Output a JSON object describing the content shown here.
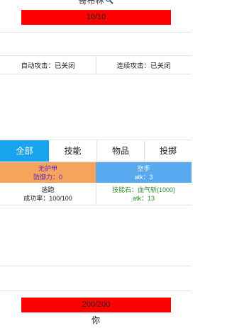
{
  "enemy": {
    "name": "哥布林",
    "hp_text": "10/10",
    "hp_fraction": 1.0
  },
  "toggles": {
    "auto_attack": "自动攻击：已关闭",
    "combo_attack": "连续攻击：已关闭"
  },
  "tabs": [
    {
      "label": "全部",
      "active": true
    },
    {
      "label": "技能",
      "active": false
    },
    {
      "label": "物品",
      "active": false
    },
    {
      "label": "投掷",
      "active": false
    }
  ],
  "equipment": {
    "armor_name": "无护甲",
    "armor_stat": "防御力：0",
    "weapon_name": "空手",
    "weapon_stat": "atk：3"
  },
  "skills": [
    {
      "name": "逃跑",
      "stat": "成功率：100/100"
    },
    {
      "name": "技能石：血气斩(1000)",
      "stat": "atk：13"
    }
  ],
  "player": {
    "name": "你",
    "hp_text": "200/200",
    "hp_fraction": 1.0
  },
  "colors": {
    "hp_bar": "#ff0000",
    "tab_active": "#1aa3ef",
    "armor_bg": "#f6a35c",
    "weapon_bg": "#5aaaf2",
    "skill_stone_text": "#2e8b2e"
  }
}
